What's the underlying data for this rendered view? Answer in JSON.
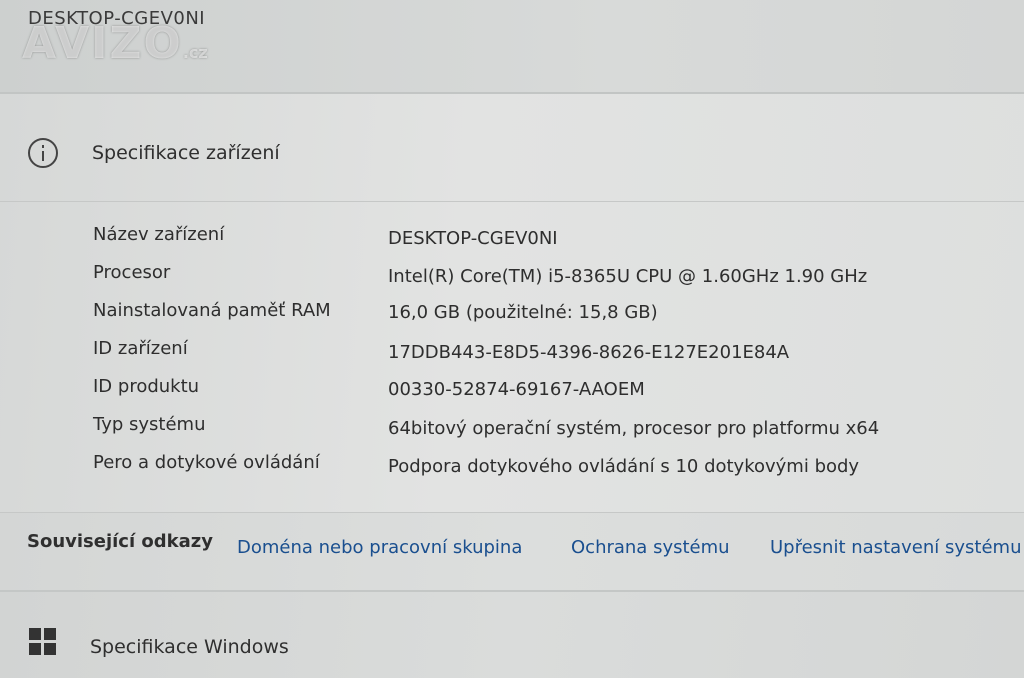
{
  "window": {
    "device_name_top": "DESKTOP-CGEV0NI",
    "watermark": "AVIZO",
    "watermark_suffix": ".cz"
  },
  "specs_card": {
    "icon": "info-icon",
    "title": "Specifikace zařízení",
    "rows": [
      {
        "label": "Název zařízení",
        "value": "DESKTOP-CGEV0NI"
      },
      {
        "label": "Procesor",
        "value": "Intel(R) Core(TM) i5-8365U CPU @ 1.60GHz   1.90 GHz"
      },
      {
        "label": "Nainstalovaná paměť RAM",
        "value": "16,0 GB (použitelné: 15,8 GB)"
      },
      {
        "label": "ID zařízení",
        "value": "17DDB443-E8D5-4396-8626-E127E201E84A"
      },
      {
        "label": "ID produktu",
        "value": "00330-52874-69167-AAOEM"
      },
      {
        "label": "Typ systému",
        "value": "64bitový operační systém, procesor pro platformu x64"
      },
      {
        "label": "Pero a dotykové ovládání",
        "value": "Podpora dotykového ovládání s 10 dotykovými body"
      }
    ]
  },
  "related_links": {
    "label": "Související odkazy",
    "links": [
      "Doména nebo pracovní skupina",
      "Ochrana systému",
      "Upřesnit nastavení systému"
    ],
    "link_color": "#1a4f8f"
  },
  "windows_specs": {
    "icon": "windows-logo-icon",
    "title": "Specifikace Windows"
  }
}
